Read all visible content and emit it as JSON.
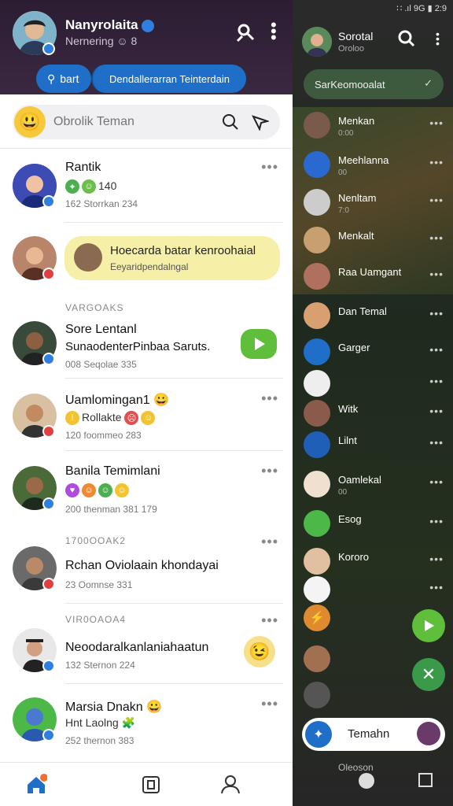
{
  "header": {
    "name": "Nanyrolaita",
    "sub": "Nernering ☺ 8",
    "pill_left": "bart",
    "pill_right": "Dendallerarran Teinterdain"
  },
  "search": {
    "placeholder": "Obrolik Teman"
  },
  "chats": [
    {
      "name": "Rantik",
      "line2": "140",
      "meta": "162 Storrkan 234"
    },
    {
      "bubble_title": "Hoecarda batar kenroohaial",
      "bubble_sub": "Eeyaridpendalngal"
    },
    {
      "section": "VARGOAKS"
    },
    {
      "name": "Sore Lentanl",
      "line2": "SunaodenterPinbaa Saruts.",
      "meta": "008 Seqolae 335"
    },
    {
      "name": "Uamlomingan1",
      "line2": "Rollakte",
      "meta": "120 foommeo 283"
    },
    {
      "name": "Banila Temimlani",
      "meta": "200 thenman 381 179"
    },
    {
      "section": "1700OOAK2"
    },
    {
      "name": "Rchan Oviolaain khondayai",
      "meta": "23 Oomnse 331"
    },
    {
      "section": "VIR0OAOA4"
    },
    {
      "name": "Neoodaralkanlaniahaatun",
      "meta": "132 Sternon 224"
    },
    {
      "name": "Marsia Dnakn",
      "line2": "Hnt Laolng",
      "meta": "252 thernon 383"
    }
  ],
  "right": {
    "status": "∷ .ıl 9G ▮ 2:9",
    "title": "Sorotal",
    "sub": "Oroloo",
    "pill": "SarKeomooalat",
    "items": [
      {
        "name": "Menkan",
        "sub": "0:00"
      },
      {
        "name": "Meehlanna",
        "sub": "00"
      },
      {
        "name": "Nenltam",
        "sub": "7:0"
      },
      {
        "name": "Menkalt",
        "sub": ""
      },
      {
        "name": "Raa Uamgant",
        "sub": ""
      },
      {
        "name": "Dan Temal",
        "sub": ""
      },
      {
        "name": "Garger",
        "sub": ""
      },
      {
        "name": "",
        "sub": ""
      },
      {
        "name": "Witk",
        "sub": ""
      },
      {
        "name": "Lilnt",
        "sub": ""
      },
      {
        "name": "Oamlekal",
        "sub": "00"
      },
      {
        "name": "Esog",
        "sub": ""
      },
      {
        "name": "Kororo",
        "sub": ""
      },
      {
        "name": "",
        "sub": ""
      }
    ],
    "bottom_label": "Temahn",
    "under": "Oleoson"
  }
}
